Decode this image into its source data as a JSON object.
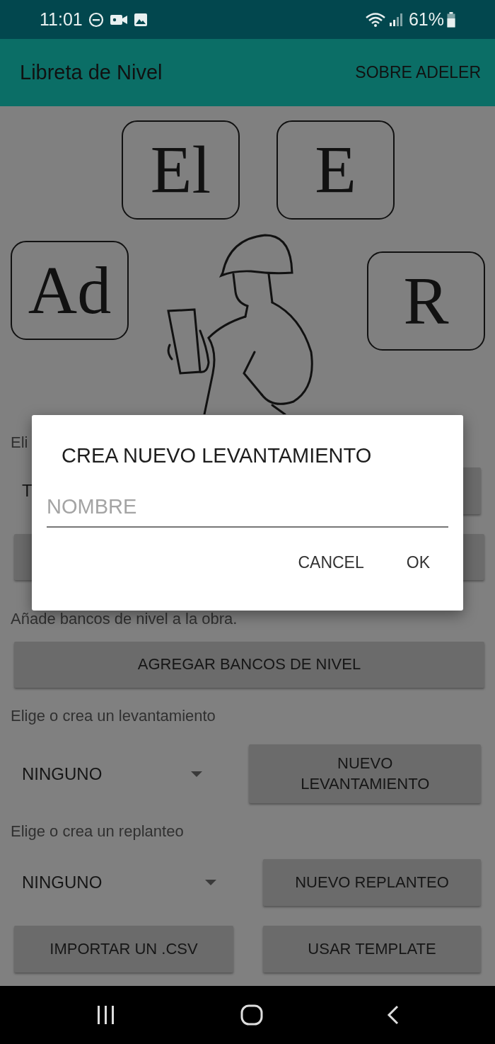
{
  "status_bar": {
    "time": "11:01",
    "battery": "61%"
  },
  "app_bar": {
    "title": "Libreta de Nivel",
    "action": "SOBRE ADELER"
  },
  "logo": {
    "tiles": [
      "El",
      "E",
      "Ad",
      "R"
    ]
  },
  "form": {
    "rows": [
      {
        "kind": "label",
        "text": "Eli"
      },
      {
        "kind": "choice",
        "value": "T"
      },
      {
        "kind": "wide_button"
      },
      {
        "kind": "label",
        "text": "Añade bancos de nivel a la obra."
      },
      {
        "kind": "wide_button",
        "label": "AGREGAR BANCOS DE NIVEL"
      },
      {
        "kind": "label",
        "text": "Elige o crea un levantamiento"
      },
      {
        "kind": "choice",
        "value": "NINGUNO",
        "caret": true,
        "button": "NUEVO LEVANTAMIENTO"
      },
      {
        "kind": "label",
        "text": "Elige o crea un replanteo"
      },
      {
        "kind": "choice",
        "value": "NINGUNO",
        "caret": true,
        "button": "NUEVO REPLANTEO"
      },
      {
        "kind": "pair",
        "buttons": [
          "IMPORTAR UN .CSV",
          "USAR TEMPLATE"
        ]
      }
    ]
  },
  "dialog": {
    "title": "CREA NUEVO LEVANTAMIENTO",
    "placeholder": "NOMBRE",
    "buttons": [
      "CANCEL",
      "OK"
    ]
  }
}
